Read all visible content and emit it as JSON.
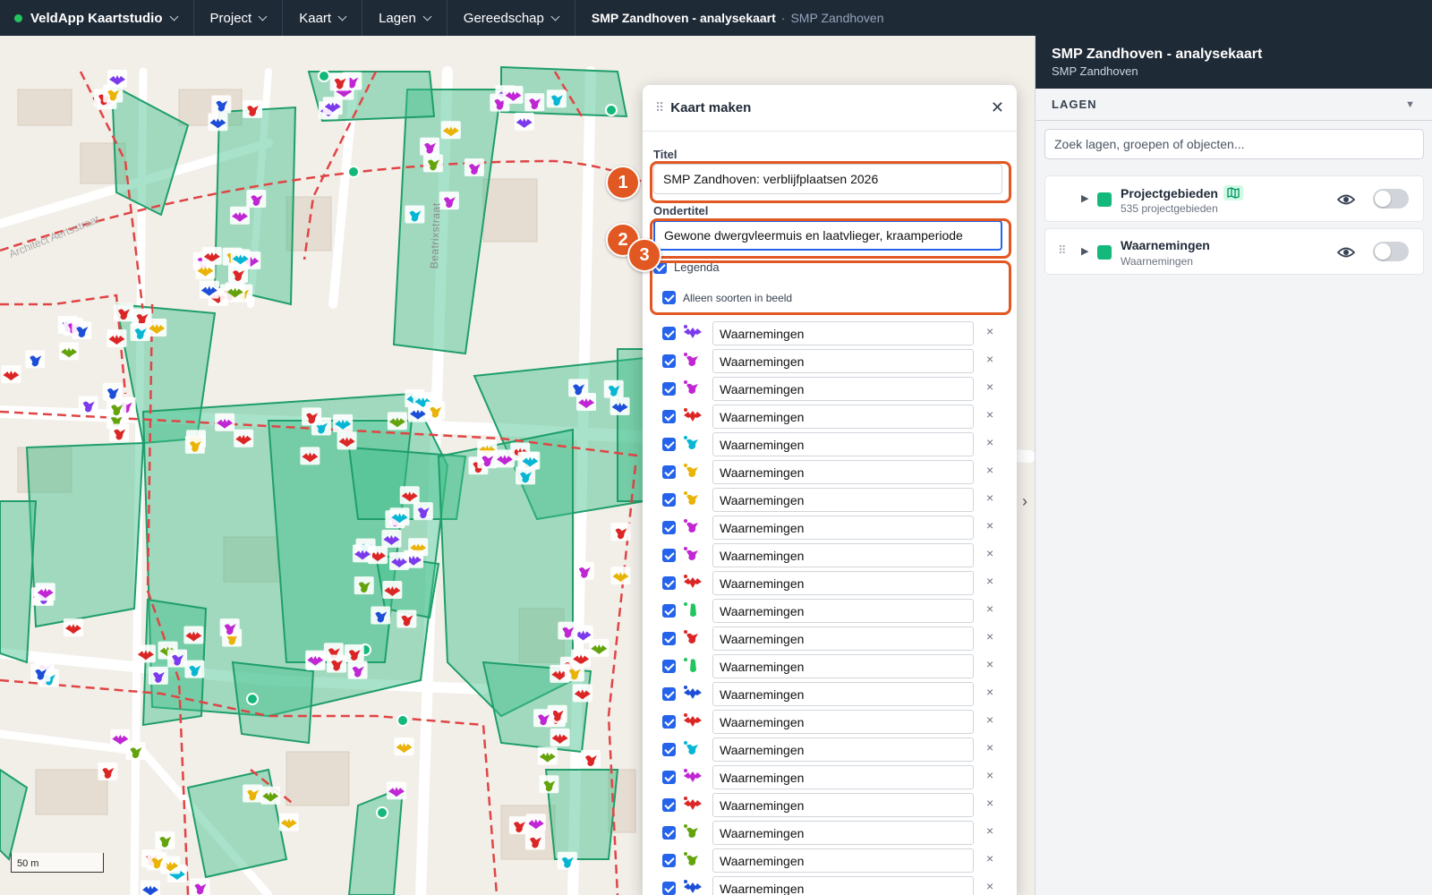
{
  "topbar": {
    "app_name": "VeldApp Kaartstudio",
    "menus": [
      "Project",
      "Kaart",
      "Lagen",
      "Gereedschap"
    ],
    "project_title": "SMP Zandhoven - analysekaart",
    "separator": "·",
    "project_sub": "SMP Zandhoven"
  },
  "map": {
    "street_label": "Beatrixstraat",
    "street_label_2": "Architect Aertsstraat",
    "scale_label": "50 m",
    "colors": {
      "area_fill": "#3fbf8a",
      "route": "#e04545",
      "background": "#f2efe9"
    }
  },
  "dialog": {
    "title": "Kaart maken",
    "title_label": "Titel",
    "title_value": "SMP Zandhoven: verblijfplaatsen 2026",
    "subtitle_label": "Ondertitel",
    "subtitle_value": "Gewone dwergvleermuis en laatvlieger, kraamperiode",
    "legend_label": "Legenda",
    "only_visible_label": "Alleen soorten in beeld",
    "legend_rows": [
      {
        "value": "Waarnemingen",
        "icon": "bat-icon",
        "color": "#7c3aed"
      },
      {
        "value": "Waarnemingen",
        "icon": "bird-icon",
        "color": "#c026d3"
      },
      {
        "value": "Waarnemingen",
        "icon": "bird-icon",
        "color": "#c026d3"
      },
      {
        "value": "Waarnemingen",
        "icon": "bat-icon",
        "color": "#dc2626"
      },
      {
        "value": "Waarnemingen",
        "icon": "bird-icon",
        "color": "#06b6d4"
      },
      {
        "value": "Waarnemingen",
        "icon": "bird-icon",
        "color": "#eab308"
      },
      {
        "value": "Waarnemingen",
        "icon": "bird-icon",
        "color": "#eab308"
      },
      {
        "value": "Waarnemingen",
        "icon": "bird-icon",
        "color": "#c026d3"
      },
      {
        "value": "Waarnemingen",
        "icon": "bird-icon",
        "color": "#c026d3"
      },
      {
        "value": "Waarnemingen",
        "icon": "bat-icon",
        "color": "#dc2626"
      },
      {
        "value": "Waarnemingen",
        "icon": "frog-icon",
        "color": "#22c55e"
      },
      {
        "value": "Waarnemingen",
        "icon": "bird-icon",
        "color": "#dc2626"
      },
      {
        "value": "Waarnemingen",
        "icon": "frog-icon",
        "color": "#22c55e"
      },
      {
        "value": "Waarnemingen",
        "icon": "bat-icon",
        "color": "#1d4ed8"
      },
      {
        "value": "Waarnemingen",
        "icon": "bat-icon",
        "color": "#dc2626"
      },
      {
        "value": "Waarnemingen",
        "icon": "bird-icon",
        "color": "#06b6d4"
      },
      {
        "value": "Waarnemingen",
        "icon": "bat-icon",
        "color": "#c026d3"
      },
      {
        "value": "Waarnemingen",
        "icon": "bat-icon",
        "color": "#dc2626"
      },
      {
        "value": "Waarnemingen",
        "icon": "bird-icon",
        "color": "#65a30d"
      },
      {
        "value": "Waarnemingen",
        "icon": "bird-icon",
        "color": "#65a30d"
      },
      {
        "value": "Waarnemingen",
        "icon": "bat-icon",
        "color": "#1d4ed8"
      }
    ],
    "callouts": [
      "1",
      "2",
      "3"
    ],
    "accent": "#e25822"
  },
  "panel": {
    "title": "SMP Zandhoven - analysekaart",
    "subtitle": "SMP Zandhoven",
    "section_label": "LAGEN",
    "search_placeholder": "Zoek lagen, groepen of objecten...",
    "layers": [
      {
        "name": "Projectgebieden",
        "sub": "535 projectgebieden",
        "color": "#14b87a"
      },
      {
        "name": "Waarnemingen",
        "sub": "Waarnemingen",
        "color": "#14b87a"
      }
    ]
  }
}
